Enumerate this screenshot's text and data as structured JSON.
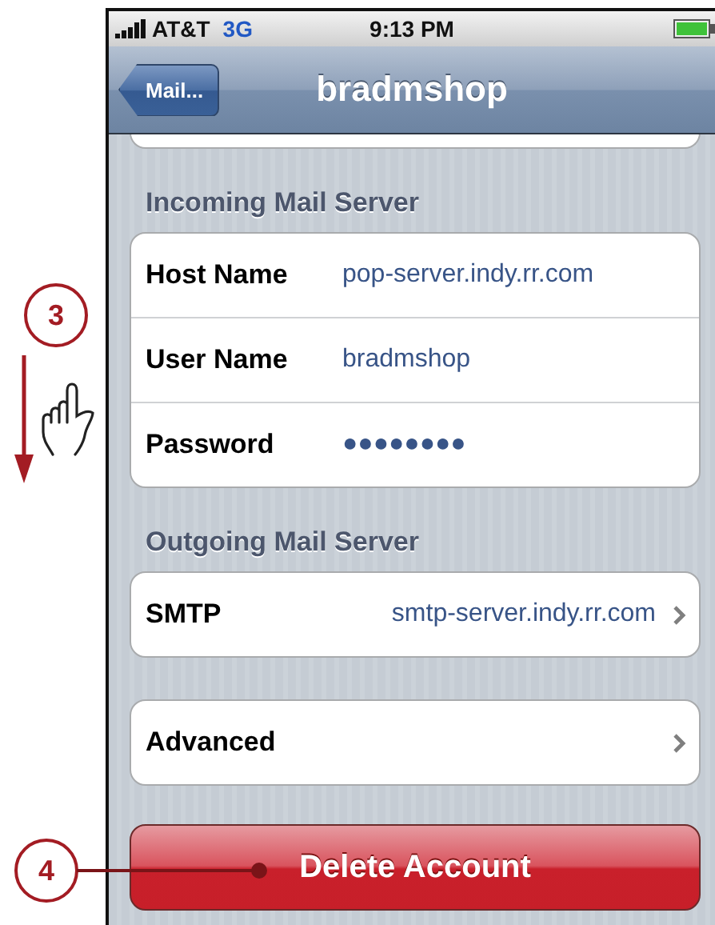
{
  "status_bar": {
    "carrier": "AT&T",
    "network": "3G",
    "time": "9:13 PM"
  },
  "nav_bar": {
    "back": "Mail...",
    "title": "bradmshop"
  },
  "sections": [
    {
      "header": "Incoming Mail Server",
      "rows": [
        {
          "label": "Host Name",
          "value": "pop-server.indy.rr.com",
          "disclosure": false
        },
        {
          "label": "User Name",
          "value": "bradmshop",
          "disclosure": false
        },
        {
          "label": "Password",
          "value": "●●●●●●●●",
          "disclosure": false
        }
      ]
    },
    {
      "header": "Outgoing Mail Server",
      "rows": [
        {
          "label": "SMTP",
          "value": "smtp-server.indy.rr.com",
          "disclosure": true
        }
      ]
    },
    {
      "rows": [
        {
          "label": "Advanced",
          "disclosure": true
        }
      ]
    }
  ],
  "delete_button": "Delete Account",
  "callouts": [
    {
      "number": "3",
      "kind": "scroll"
    },
    {
      "number": "4",
      "kind": "pointer"
    }
  ]
}
